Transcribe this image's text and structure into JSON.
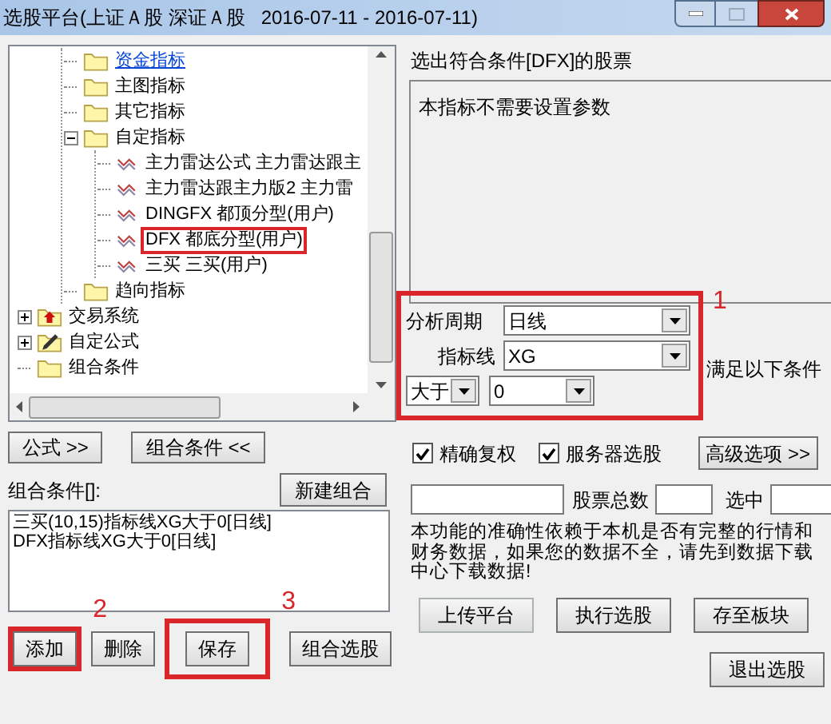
{
  "window": {
    "title": "选股平台(上证Ａ股 深证Ａ股   2016-07-11 - 2016-07-11)"
  },
  "tree": {
    "items": [
      {
        "children": [
          {
            "label": "资金指标",
            "kind": "folder",
            "hot": true,
            "boxed": false
          },
          {
            "label": "主图指标",
            "kind": "folder",
            "hot": false,
            "boxed": false
          },
          {
            "label": "其它指标",
            "kind": "folder",
            "hot": false,
            "boxed": false
          },
          {
            "label": "自定指标",
            "kind": "folder",
            "hot": false,
            "boxed": false,
            "expanded": true,
            "children": [
              {
                "label": "主力雷达公式 主力雷达跟主",
                "kind": "formula",
                "hot": false,
                "boxed": false
              },
              {
                "label": "主力雷达跟主力版2 主力雷",
                "kind": "formula",
                "hot": false,
                "boxed": false
              },
              {
                "label": "DINGFX 都顶分型(用户)",
                "kind": "formula",
                "hot": false,
                "boxed": false
              },
              {
                "label": "DFX 都底分型(用户)",
                "kind": "formula",
                "hot": false,
                "boxed": true
              },
              {
                "label": "三买 三买(用户)",
                "kind": "formula",
                "hot": false,
                "boxed": false
              }
            ]
          },
          {
            "label": "趋向指标",
            "kind": "folder",
            "hot": false,
            "boxed": false
          }
        ]
      },
      {
        "label": "交易系统",
        "kind": "system",
        "hot": false,
        "boxed": false,
        "expanded": false
      },
      {
        "label": "自定公式",
        "kind": "edit",
        "hot": false,
        "boxed": false,
        "expanded": false
      },
      {
        "label": "组合条件",
        "kind": "folder",
        "hot": false,
        "boxed": false
      }
    ]
  },
  "mode_buttons": [
    "公式 >>",
    "组合条件 <<"
  ],
  "combo": {
    "label": "组合条件[]:",
    "new_button": "新建组合",
    "lines": [
      "三买(10,15)指标线XG大于0[日线]",
      "DFX指标线XG大于0[日线]"
    ]
  },
  "combo_buttons": [
    {
      "label": "添加",
      "boxed": true,
      "mark": "2"
    },
    {
      "label": "删除",
      "boxed": false
    },
    {
      "label": "保存",
      "boxed": true,
      "mark": "3"
    },
    {
      "label": "组合选股",
      "boxed": false
    }
  ],
  "selection": {
    "title": "选出符合条件[DFX]的股票",
    "note": "本指标不需要设置参数"
  },
  "params": {
    "mark": "1",
    "period_label": "分析周期",
    "period": "日线",
    "line_label": "指标线",
    "line": "XG",
    "compare": "大于",
    "value": "0",
    "suffix": "满足以下条件"
  },
  "options": [
    {
      "label": "精确复权",
      "checked": true
    },
    {
      "label": "服务器选股",
      "checked": true
    }
  ],
  "advanced_button": "高级选项 >>",
  "stats": {
    "total_label": "股票总数",
    "selected_label": "选中"
  },
  "notice": "本功能的准确性依赖于本机是否有完整的行情和财务数据，如果您的数据不全，请先到数据下载中心下载数据!",
  "actions": [
    {
      "label": "上传平台",
      "disabled": true
    },
    {
      "label": "执行选股",
      "disabled": false
    },
    {
      "label": "存至板块",
      "disabled": false
    }
  ],
  "exit_button": "退出选股"
}
